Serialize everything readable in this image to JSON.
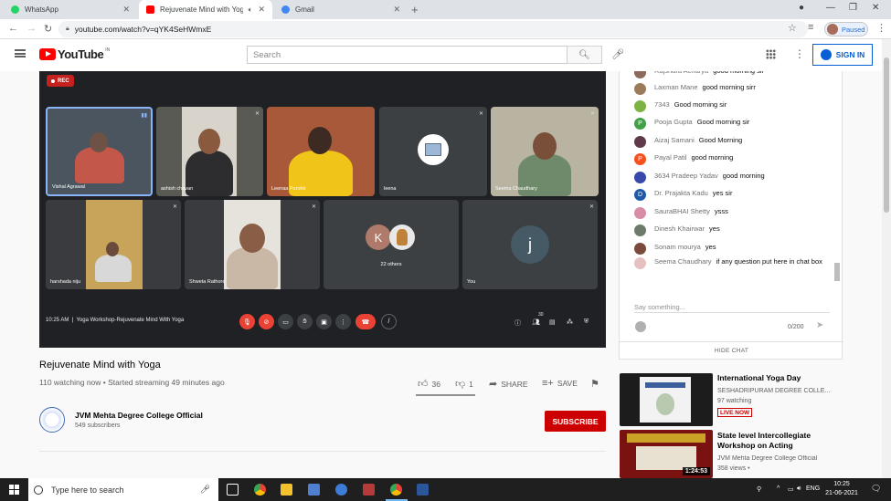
{
  "browser": {
    "tabs": [
      {
        "title": "WhatsApp",
        "color": "#25d366",
        "active": false
      },
      {
        "title": "Rejuvenate Mind with Yoga",
        "color": "#ff0000",
        "active": true
      },
      {
        "title": "Gmail",
        "color": "#4285f4",
        "active": false
      }
    ],
    "url": "youtube.com/watch?v=qYK4SeHWmxE",
    "profile_status": "Paused"
  },
  "youtube": {
    "logo_text": "YouTube",
    "region": "IN",
    "search_placeholder": "Search",
    "signin_label": "SIGN IN"
  },
  "meet": {
    "rec_label": "REC",
    "time": "10:25 AM",
    "meeting_title": "Yoga Workshop-Rejuvenate Mind With Yoga",
    "participants": [
      {
        "name": "Vishal Agrawal"
      },
      {
        "name": "ashish chavan"
      },
      {
        "name": "Leenaa Purohit"
      },
      {
        "name": "leena"
      },
      {
        "name": "Seema Chaudhary"
      },
      {
        "name": "harshada niju"
      },
      {
        "name": "Shweta Rathore"
      },
      {
        "name": "22 others",
        "letter": "K"
      },
      {
        "name": "You",
        "letter": "j"
      }
    ],
    "notification_count": "30"
  },
  "video": {
    "title": "Rejuvenate Mind with Yoga",
    "meta": "110 watching now • Started streaming 49 minutes ago",
    "likes": "36",
    "dislikes": "1",
    "share_label": "SHARE",
    "save_label": "SAVE"
  },
  "channel": {
    "name": "JVM Mehta Degree College Official",
    "subscribers": "549 subscribers",
    "subscribe_label": "SUBSCRIBE"
  },
  "chat": {
    "messages": [
      {
        "author": "Rajshara Acharya",
        "text": "good morning sir",
        "color": "#8e6a5c",
        "initial": ""
      },
      {
        "author": "Laxman Mane",
        "text": "good morning sirr",
        "color": "#9c7b5b",
        "initial": ""
      },
      {
        "author": "7343",
        "text": "Good morning sir",
        "color": "#7cb342",
        "initial": ""
      },
      {
        "author": "Pooja Gupta",
        "text": "Good morning sir",
        "color": "#43a047",
        "initial": "P"
      },
      {
        "author": "Aizaj Samani",
        "text": "Good Morning",
        "color": "#5e3a4a",
        "initial": ""
      },
      {
        "author": "Payal Patil",
        "text": "good morning",
        "color": "#f4511e",
        "initial": "P"
      },
      {
        "author": "3634 Pradeep Yadav",
        "text": "good morning",
        "color": "#3949ab",
        "initial": ""
      },
      {
        "author": "Dr. Prajakta Kadu",
        "text": "yes sir",
        "color": "#1e5aa8",
        "initial": "D"
      },
      {
        "author": "SauraBHAI Shetty",
        "text": "ysss",
        "color": "#d98ca8",
        "initial": ""
      },
      {
        "author": "Dinesh Khairwar",
        "text": "yes",
        "color": "#6d7b6a",
        "initial": ""
      },
      {
        "author": "Sonam mourya",
        "text": "yes",
        "color": "#7a4b3a",
        "initial": ""
      },
      {
        "author": "Seema Chaudhary",
        "text": "if any question put here in chat box",
        "color": "#e6c1c1",
        "initial": ""
      }
    ],
    "input_placeholder": "Say something...",
    "char_count": "0/200",
    "hide_label": "HIDE CHAT"
  },
  "recommendations": [
    {
      "title": "International Yoga Day",
      "channel": "SESHADRIPURAM DEGREE COLLE...",
      "stat": "97 watching",
      "badge": "LIVE NOW",
      "duration": ""
    },
    {
      "title": "State level Intercollegiate Workshop on Acting",
      "channel": "JVM Mehta Degree College Official",
      "stat": "358 views •",
      "badge": "",
      "duration": "1:24:53"
    }
  ],
  "taskbar": {
    "search_placeholder": "Type here to search",
    "language": "ENG",
    "time": "10:25",
    "date": "21-06-2021"
  }
}
